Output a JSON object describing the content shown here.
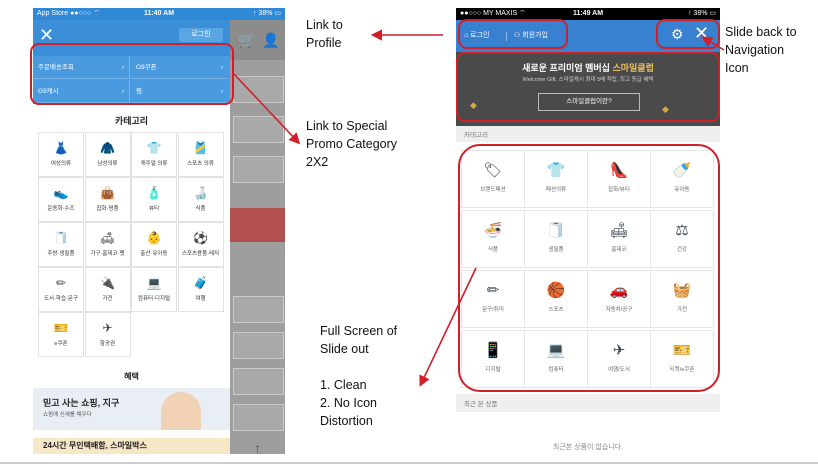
{
  "left_phone": {
    "status": {
      "carrier": "App Store ●●○○○ ⌔",
      "time": "11:40 AM",
      "battery": "↑ 38% ▭"
    },
    "close_icon": "close-icon",
    "login_button": "로그인",
    "promo_links": [
      "주문배송조회",
      "G9쿠폰",
      "G9캐시",
      "찜"
    ],
    "category_title": "카테고리",
    "categories": [
      {
        "icon": "dress-icon",
        "glyph": "👗",
        "label": "여성의류"
      },
      {
        "icon": "jacket-icon",
        "glyph": "🧥",
        "label": "남성의류"
      },
      {
        "icon": "tshirt-icon",
        "glyph": "👕",
        "label": "캐주얼 의류"
      },
      {
        "icon": "sports-shirt-icon",
        "glyph": "🎽",
        "label": "스포츠 의류"
      },
      {
        "icon": "shoe-icon",
        "glyph": "👟",
        "label": "운동화·수즈"
      },
      {
        "icon": "bag-icon",
        "glyph": "👜",
        "label": "잡화·명품"
      },
      {
        "icon": "cosmetic-icon",
        "glyph": "🧴",
        "label": "뷰티"
      },
      {
        "icon": "bottle-icon",
        "glyph": "🍶",
        "label": "식품"
      },
      {
        "icon": "tissue-icon",
        "glyph": "🧻",
        "label": "주방·생필품"
      },
      {
        "icon": "sofa-icon",
        "glyph": "🛋",
        "label": "가구·홈데코·펫"
      },
      {
        "icon": "stroller-icon",
        "glyph": "👶",
        "label": "출산·유아동"
      },
      {
        "icon": "ball-icon",
        "glyph": "⚽",
        "label": "스포츠용품·레저"
      },
      {
        "icon": "pencil-icon",
        "glyph": "✏",
        "label": "도서·학습·문구"
      },
      {
        "icon": "appliance-icon",
        "glyph": "🔌",
        "label": "가전"
      },
      {
        "icon": "laptop-icon",
        "glyph": "💻",
        "label": "컴퓨터·디지털"
      },
      {
        "icon": "luggage-icon",
        "glyph": "🧳",
        "label": "여행"
      },
      {
        "icon": "coupon-icon",
        "glyph": "🎫",
        "label": "e쿠폰"
      },
      {
        "icon": "airplane-icon",
        "glyph": "✈",
        "label": "항공권"
      }
    ],
    "benefit_title": "혜택",
    "benefit_banner_1": {
      "title": "믿고 사는 쇼핑, 지구",
      "subtitle": "쇼핑에 신세를 채우다"
    },
    "benefit_banner_2": {
      "title": "24시간 무인택배함, 스마일박스"
    },
    "scroll_top_icon": "↑"
  },
  "right_phone": {
    "status": {
      "carrier": "●●○○○ MY MAXIS ⌔",
      "time": "11:49 AM",
      "battery": "↑ 38% ▭"
    },
    "login_label": "⌂ 로그인",
    "join_label": "⚇ 회원가입",
    "banner": {
      "title_prefix": "새로운 프리미엄 멤버십 ",
      "title_highlight": "스마일클럽",
      "subtitle": "Welcome Gift, 스마일캐시 최대 5배 적립, 최고 등급 혜택",
      "button": "스마일클럽이란?"
    },
    "category_header": "카테고리",
    "categories": [
      {
        "icon": "brand-tag-icon",
        "glyph": "🏷",
        "label": "브랜드패션"
      },
      {
        "icon": "tshirt-icon",
        "glyph": "👕",
        "label": "패션의류"
      },
      {
        "icon": "high-heel-icon",
        "glyph": "👠",
        "label": "잡화/뷰티"
      },
      {
        "icon": "baby-bottle-icon",
        "glyph": "🍼",
        "label": "유아동"
      },
      {
        "icon": "noodle-bowl-icon",
        "glyph": "🍜",
        "label": "식품"
      },
      {
        "icon": "toilet-paper-icon",
        "glyph": "🧻",
        "label": "생필품"
      },
      {
        "icon": "sofa-icon",
        "glyph": "🛋",
        "label": "홈데코"
      },
      {
        "icon": "scale-icon",
        "glyph": "⚖",
        "label": "건강"
      },
      {
        "icon": "pencil-icon",
        "glyph": "✏",
        "label": "문구/취미"
      },
      {
        "icon": "basketball-icon",
        "glyph": "🏀",
        "label": "스포츠"
      },
      {
        "icon": "car-icon",
        "glyph": "🚗",
        "label": "자동차/공구"
      },
      {
        "icon": "washer-icon",
        "glyph": "🧺",
        "label": "가전"
      },
      {
        "icon": "phone-icon",
        "glyph": "📱",
        "label": "디지털"
      },
      {
        "icon": "laptop-icon",
        "glyph": "💻",
        "label": "컴퓨터"
      },
      {
        "icon": "airplane-icon",
        "glyph": "✈",
        "label": "여행/도서"
      },
      {
        "icon": "ticket-icon",
        "glyph": "🎫",
        "label": "티켓/e쿠폰"
      }
    ],
    "recent_header": "최근 본 상품",
    "recent_empty": "최근본 상품이 없습니다."
  },
  "annotations": {
    "profile": "Link to\nProfile",
    "special_promo": "Link to Special\nPromo Category\n2X2",
    "slide_back": "Slide back to\nNavigation\nIcon",
    "full_screen": "Full Screen of\nSlide out\n\n1. Clean\n2. No Icon\nDistortion"
  },
  "accent_colors": {
    "blue": "#3880d0",
    "highlight_red": "#d11f2a",
    "gold": "#f2c15a"
  }
}
